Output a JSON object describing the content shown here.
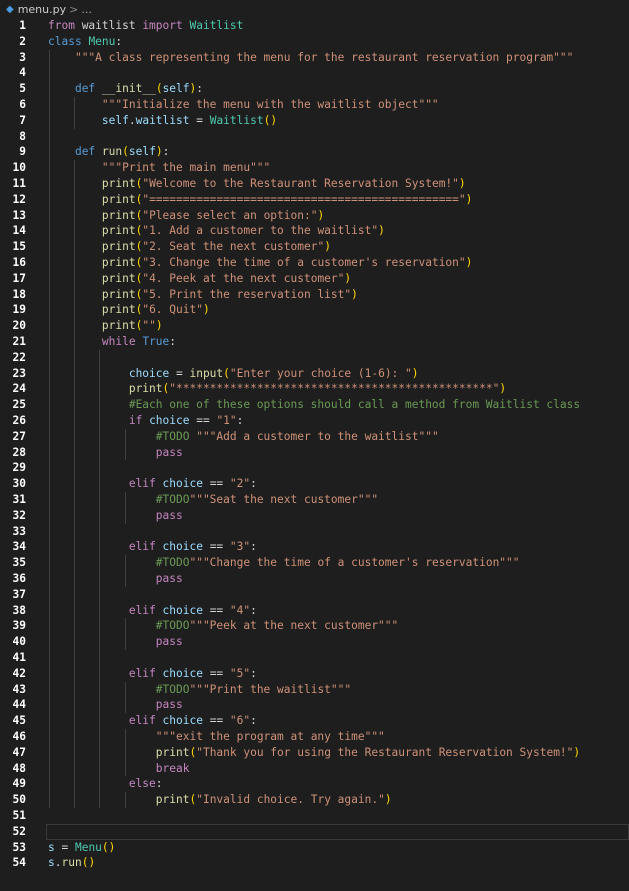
{
  "breadcrumb": {
    "file": "menu.py",
    "rest": "..."
  },
  "lines": [
    {
      "n": "1",
      "tokens": [
        [
          "kwc",
          "from"
        ],
        [
          "pl",
          " waitlist "
        ],
        [
          "kwc",
          "import"
        ],
        [
          "pl",
          " "
        ],
        [
          "cls",
          "Waitlist"
        ]
      ]
    },
    {
      "n": "2",
      "tokens": [
        [
          "kw",
          "class"
        ],
        [
          "pl",
          " "
        ],
        [
          "cls",
          "Menu"
        ],
        [
          "pl",
          ":"
        ]
      ]
    },
    {
      "n": "3",
      "tokens": [
        [
          "pl",
          "    "
        ],
        [
          "str",
          "\"\"\"A class representing the menu for the restaurant reservation program\"\"\""
        ]
      ]
    },
    {
      "n": "4",
      "tokens": []
    },
    {
      "n": "5",
      "tokens": [
        [
          "pl",
          "    "
        ],
        [
          "kw",
          "def"
        ],
        [
          "pl",
          " "
        ],
        [
          "fn",
          "__init__"
        ],
        [
          "paren",
          "("
        ],
        [
          "var",
          "self"
        ],
        [
          "paren",
          ")"
        ],
        [
          "pl",
          ":"
        ]
      ]
    },
    {
      "n": "6",
      "tokens": [
        [
          "pl",
          "        "
        ],
        [
          "str",
          "\"\"\"Initialize the menu with the waitlist object\"\"\""
        ]
      ]
    },
    {
      "n": "7",
      "tokens": [
        [
          "pl",
          "        "
        ],
        [
          "var",
          "self"
        ],
        [
          "pl",
          "."
        ],
        [
          "var",
          "waitlist"
        ],
        [
          "pl",
          " = "
        ],
        [
          "cls",
          "Waitlist"
        ],
        [
          "paren",
          "()"
        ]
      ]
    },
    {
      "n": "8",
      "tokens": []
    },
    {
      "n": "9",
      "tokens": [
        [
          "pl",
          "    "
        ],
        [
          "kw",
          "def"
        ],
        [
          "pl",
          " "
        ],
        [
          "fn",
          "run"
        ],
        [
          "paren",
          "("
        ],
        [
          "var",
          "self"
        ],
        [
          "paren",
          ")"
        ],
        [
          "pl",
          ":"
        ]
      ]
    },
    {
      "n": "10",
      "tokens": [
        [
          "pl",
          "        "
        ],
        [
          "str",
          "\"\"\"Print the main menu\"\"\""
        ]
      ]
    },
    {
      "n": "11",
      "tokens": [
        [
          "pl",
          "        "
        ],
        [
          "fn",
          "print"
        ],
        [
          "paren",
          "("
        ],
        [
          "str",
          "\"Welcome to the Restaurant Reservation System!\""
        ],
        [
          "paren",
          ")"
        ]
      ]
    },
    {
      "n": "12",
      "tokens": [
        [
          "pl",
          "        "
        ],
        [
          "fn",
          "print"
        ],
        [
          "paren",
          "("
        ],
        [
          "str",
          "\"==============================================\""
        ],
        [
          "paren",
          ")"
        ]
      ]
    },
    {
      "n": "13",
      "tokens": [
        [
          "pl",
          "        "
        ],
        [
          "fn",
          "print"
        ],
        [
          "paren",
          "("
        ],
        [
          "str",
          "\"Please select an option:\""
        ],
        [
          "paren",
          ")"
        ]
      ]
    },
    {
      "n": "14",
      "tokens": [
        [
          "pl",
          "        "
        ],
        [
          "fn",
          "print"
        ],
        [
          "paren",
          "("
        ],
        [
          "str",
          "\"1. Add a customer to the waitlist\""
        ],
        [
          "paren",
          ")"
        ]
      ]
    },
    {
      "n": "15",
      "tokens": [
        [
          "pl",
          "        "
        ],
        [
          "fn",
          "print"
        ],
        [
          "paren",
          "("
        ],
        [
          "str",
          "\"2. Seat the next customer\""
        ],
        [
          "paren",
          ")"
        ]
      ]
    },
    {
      "n": "16",
      "tokens": [
        [
          "pl",
          "        "
        ],
        [
          "fn",
          "print"
        ],
        [
          "paren",
          "("
        ],
        [
          "str",
          "\"3. Change the time of a customer's reservation\""
        ],
        [
          "paren",
          ")"
        ]
      ]
    },
    {
      "n": "17",
      "tokens": [
        [
          "pl",
          "        "
        ],
        [
          "fn",
          "print"
        ],
        [
          "paren",
          "("
        ],
        [
          "str",
          "\"4. Peek at the next customer\""
        ],
        [
          "paren",
          ")"
        ]
      ]
    },
    {
      "n": "18",
      "tokens": [
        [
          "pl",
          "        "
        ],
        [
          "fn",
          "print"
        ],
        [
          "paren",
          "("
        ],
        [
          "str",
          "\"5. Print the reservation list\""
        ],
        [
          "paren",
          ")"
        ]
      ]
    },
    {
      "n": "19",
      "tokens": [
        [
          "pl",
          "        "
        ],
        [
          "fn",
          "print"
        ],
        [
          "paren",
          "("
        ],
        [
          "str",
          "\"6. Quit\""
        ],
        [
          "paren",
          ")"
        ]
      ]
    },
    {
      "n": "20",
      "tokens": [
        [
          "pl",
          "        "
        ],
        [
          "fn",
          "print"
        ],
        [
          "paren",
          "("
        ],
        [
          "str",
          "\"\""
        ],
        [
          "paren",
          ")"
        ]
      ]
    },
    {
      "n": "21",
      "tokens": [
        [
          "pl",
          "        "
        ],
        [
          "kwc",
          "while"
        ],
        [
          "pl",
          " "
        ],
        [
          "kw",
          "True"
        ],
        [
          "pl",
          ":"
        ]
      ]
    },
    {
      "n": "22",
      "tokens": []
    },
    {
      "n": "23",
      "tokens": [
        [
          "pl",
          "            "
        ],
        [
          "var",
          "choice"
        ],
        [
          "pl",
          " = "
        ],
        [
          "fn",
          "input"
        ],
        [
          "paren",
          "("
        ],
        [
          "str",
          "\"Enter your choice (1-6): \""
        ],
        [
          "paren",
          ")"
        ]
      ]
    },
    {
      "n": "24",
      "tokens": [
        [
          "pl",
          "            "
        ],
        [
          "fn",
          "print"
        ],
        [
          "paren",
          "("
        ],
        [
          "str",
          "\"***********************************************\""
        ],
        [
          "paren",
          ")"
        ]
      ]
    },
    {
      "n": "25",
      "tokens": [
        [
          "pl",
          "            "
        ],
        [
          "cmt",
          "#Each one of these options should call a method from Waitlist class"
        ]
      ]
    },
    {
      "n": "26",
      "tokens": [
        [
          "pl",
          "            "
        ],
        [
          "kwc",
          "if"
        ],
        [
          "pl",
          " "
        ],
        [
          "var",
          "choice"
        ],
        [
          "pl",
          " == "
        ],
        [
          "str",
          "\"1\""
        ],
        [
          "pl",
          ":"
        ]
      ]
    },
    {
      "n": "27",
      "tokens": [
        [
          "pl",
          "                "
        ],
        [
          "cmt",
          "#TODO "
        ],
        [
          "str",
          "\"\"\"Add a customer to the waitlist\"\"\""
        ]
      ]
    },
    {
      "n": "28",
      "tokens": [
        [
          "pl",
          "                "
        ],
        [
          "kwc",
          "pass"
        ]
      ]
    },
    {
      "n": "29",
      "tokens": []
    },
    {
      "n": "30",
      "tokens": [
        [
          "pl",
          "            "
        ],
        [
          "kwc",
          "elif"
        ],
        [
          "pl",
          " "
        ],
        [
          "var",
          "choice"
        ],
        [
          "pl",
          " == "
        ],
        [
          "str",
          "\"2\""
        ],
        [
          "pl",
          ":"
        ]
      ]
    },
    {
      "n": "31",
      "tokens": [
        [
          "pl",
          "                "
        ],
        [
          "cmt",
          "#TODO"
        ],
        [
          "str",
          "\"\"\"Seat the next customer\"\"\""
        ]
      ]
    },
    {
      "n": "32",
      "tokens": [
        [
          "pl",
          "                "
        ],
        [
          "kwc",
          "pass"
        ]
      ]
    },
    {
      "n": "33",
      "tokens": []
    },
    {
      "n": "34",
      "tokens": [
        [
          "pl",
          "            "
        ],
        [
          "kwc",
          "elif"
        ],
        [
          "pl",
          " "
        ],
        [
          "var",
          "choice"
        ],
        [
          "pl",
          " == "
        ],
        [
          "str",
          "\"3\""
        ],
        [
          "pl",
          ":"
        ]
      ]
    },
    {
      "n": "35",
      "tokens": [
        [
          "pl",
          "                "
        ],
        [
          "cmt",
          "#TODO"
        ],
        [
          "str",
          "\"\"\"Change the time of a customer's reservation\"\"\""
        ]
      ]
    },
    {
      "n": "36",
      "tokens": [
        [
          "pl",
          "                "
        ],
        [
          "kwc",
          "pass"
        ]
      ]
    },
    {
      "n": "37",
      "tokens": []
    },
    {
      "n": "38",
      "tokens": [
        [
          "pl",
          "            "
        ],
        [
          "kwc",
          "elif"
        ],
        [
          "pl",
          " "
        ],
        [
          "var",
          "choice"
        ],
        [
          "pl",
          " == "
        ],
        [
          "str",
          "\"4\""
        ],
        [
          "pl",
          ":"
        ]
      ]
    },
    {
      "n": "39",
      "tokens": [
        [
          "pl",
          "                "
        ],
        [
          "cmt",
          "#TODO"
        ],
        [
          "str",
          "\"\"\"Peek at the next customer\"\"\""
        ]
      ]
    },
    {
      "n": "40",
      "tokens": [
        [
          "pl",
          "                "
        ],
        [
          "kwc",
          "pass"
        ]
      ]
    },
    {
      "n": "41",
      "tokens": []
    },
    {
      "n": "42",
      "tokens": [
        [
          "pl",
          "            "
        ],
        [
          "kwc",
          "elif"
        ],
        [
          "pl",
          " "
        ],
        [
          "var",
          "choice"
        ],
        [
          "pl",
          " == "
        ],
        [
          "str",
          "\"5\""
        ],
        [
          "pl",
          ":"
        ]
      ]
    },
    {
      "n": "43",
      "tokens": [
        [
          "pl",
          "                "
        ],
        [
          "cmt",
          "#TODO"
        ],
        [
          "str",
          "\"\"\"Print the waitlist\"\"\""
        ]
      ]
    },
    {
      "n": "44",
      "tokens": [
        [
          "pl",
          "                "
        ],
        [
          "kwc",
          "pass"
        ]
      ]
    },
    {
      "n": "45",
      "tokens": [
        [
          "pl",
          "            "
        ],
        [
          "kwc",
          "elif"
        ],
        [
          "pl",
          " "
        ],
        [
          "var",
          "choice"
        ],
        [
          "pl",
          " == "
        ],
        [
          "str",
          "\"6\""
        ],
        [
          "pl",
          ":"
        ]
      ]
    },
    {
      "n": "46",
      "tokens": [
        [
          "pl",
          "                "
        ],
        [
          "str",
          "\"\"\"exit the program at any time\"\"\""
        ]
      ]
    },
    {
      "n": "47",
      "tokens": [
        [
          "pl",
          "                "
        ],
        [
          "fn",
          "print"
        ],
        [
          "paren",
          "("
        ],
        [
          "str",
          "\"Thank you for using the Restaurant Reservation System!\""
        ],
        [
          "paren",
          ")"
        ]
      ]
    },
    {
      "n": "48",
      "tokens": [
        [
          "pl",
          "                "
        ],
        [
          "kwc",
          "break"
        ]
      ]
    },
    {
      "n": "49",
      "tokens": [
        [
          "pl",
          "            "
        ],
        [
          "kwc",
          "else"
        ],
        [
          "pl",
          ":"
        ]
      ]
    },
    {
      "n": "50",
      "tokens": [
        [
          "pl",
          "                "
        ],
        [
          "fn",
          "print"
        ],
        [
          "paren",
          "("
        ],
        [
          "str",
          "\"Invalid choice. Try again.\""
        ],
        [
          "paren",
          ")"
        ]
      ]
    },
    {
      "n": "51",
      "tokens": []
    },
    {
      "n": "52",
      "tokens": []
    },
    {
      "n": "53",
      "tokens": [
        [
          "var",
          "s"
        ],
        [
          "pl",
          " = "
        ],
        [
          "cls",
          "Menu"
        ],
        [
          "paren",
          "()"
        ]
      ]
    },
    {
      "n": "54",
      "tokens": [
        [
          "var",
          "s"
        ],
        [
          "pl",
          "."
        ],
        [
          "fn",
          "run"
        ],
        [
          "paren",
          "()"
        ]
      ]
    }
  ],
  "colors": {
    "background": "#1e1e1e",
    "keyword": "#569cd6",
    "control": "#c586c0",
    "function": "#dcdcaa",
    "class": "#4ec9b0",
    "string": "#ce9178",
    "comment": "#6a9955",
    "variable": "#9cdcfe"
  }
}
